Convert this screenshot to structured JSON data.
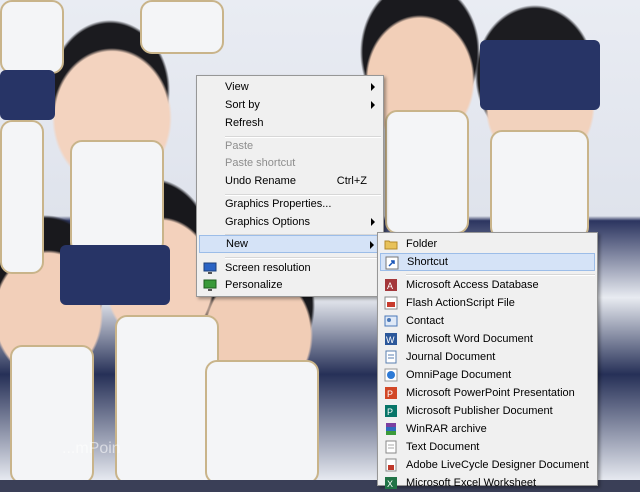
{
  "wallpaper": {
    "watermark_text": "...mPoin"
  },
  "context_menu": {
    "items": [
      {
        "label": "View"
      },
      {
        "label": "Sort by"
      },
      {
        "label": "Refresh"
      },
      {
        "label": "Paste"
      },
      {
        "label": "Paste shortcut"
      },
      {
        "label": "Undo Rename",
        "shortcut": "Ctrl+Z"
      },
      {
        "label": "Graphics Properties..."
      },
      {
        "label": "Graphics Options"
      },
      {
        "label": "New"
      },
      {
        "label": "Screen resolution"
      },
      {
        "label": "Personalize"
      }
    ]
  },
  "new_submenu": {
    "items": [
      {
        "label": "Folder"
      },
      {
        "label": "Shortcut"
      },
      {
        "label": "Microsoft Access Database"
      },
      {
        "label": "Flash ActionScript File"
      },
      {
        "label": "Contact"
      },
      {
        "label": "Microsoft Word Document"
      },
      {
        "label": "Journal Document"
      },
      {
        "label": "OmniPage Document"
      },
      {
        "label": "Microsoft PowerPoint Presentation"
      },
      {
        "label": "Microsoft Publisher Document"
      },
      {
        "label": "WinRAR archive"
      },
      {
        "label": "Text Document"
      },
      {
        "label": "Adobe LiveCycle Designer Document"
      },
      {
        "label": "Microsoft Excel Worksheet"
      }
    ]
  },
  "colors": {
    "menu_bg": "#f0f0f0",
    "highlight": "#d5e3f7",
    "highlight_border": "#9cbde8",
    "disabled_text": "#8d8d8d"
  }
}
